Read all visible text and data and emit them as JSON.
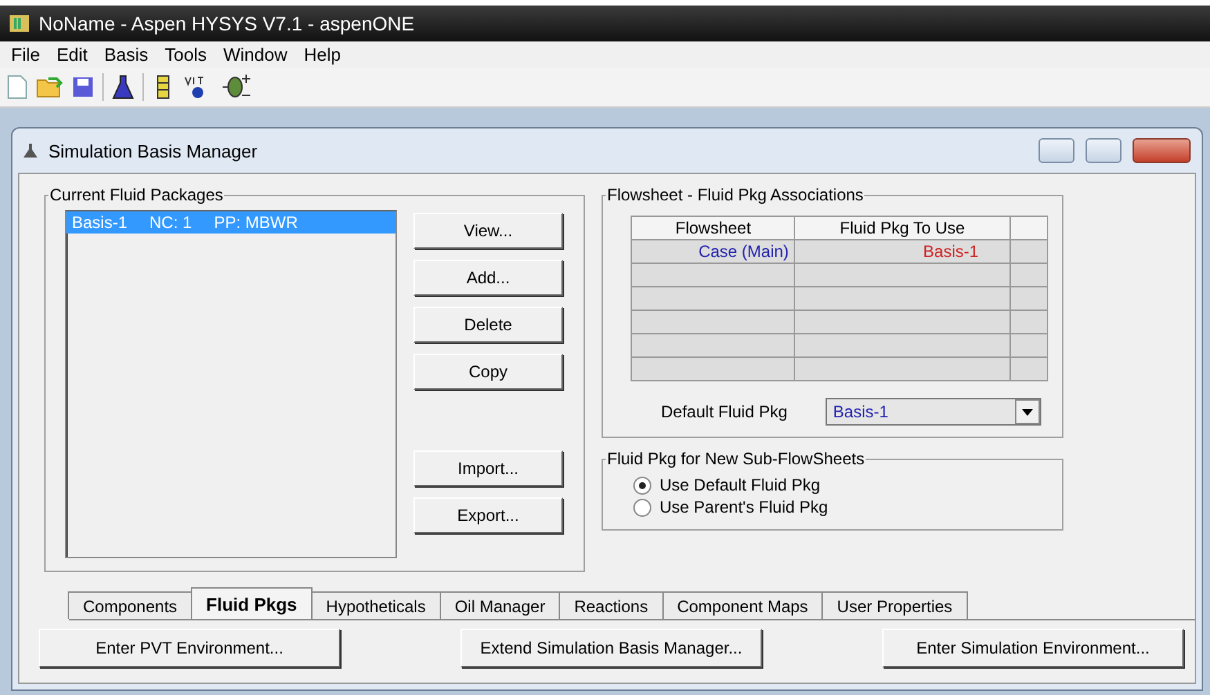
{
  "window": {
    "title": "NoName - Aspen HYSYS V7.1 - aspenONE"
  },
  "menu": [
    "File",
    "Edit",
    "Basis",
    "Tools",
    "Window",
    "Help"
  ],
  "child_window": {
    "title": "Simulation Basis Manager"
  },
  "current_fluid_packages": {
    "title": "Current Fluid Packages",
    "items": [
      {
        "name": "Basis-1",
        "nc": "NC: 1",
        "pp": "PP: MBWR",
        "selected": true
      }
    ],
    "buttons": [
      "View...",
      "Add...",
      "Delete",
      "Copy"
    ],
    "buttons_lower": [
      "Import...",
      "Export..."
    ]
  },
  "associations": {
    "title": "Flowsheet - Fluid Pkg Associations",
    "columns": [
      "Flowsheet",
      "Fluid Pkg To Use"
    ],
    "rows": [
      {
        "flowsheet": "Case (Main)",
        "fluid_pkg": "Basis-1"
      }
    ],
    "default_label": "Default Fluid Pkg",
    "default_value": "Basis-1"
  },
  "new_subflowsheets": {
    "title": "Fluid Pkg for New Sub-FlowSheets",
    "options": [
      {
        "label": "Use Default Fluid Pkg",
        "selected": true
      },
      {
        "label": "Use Parent's Fluid Pkg",
        "selected": false
      }
    ]
  },
  "tabs": [
    {
      "label": "Components",
      "selected": false
    },
    {
      "label": "Fluid Pkgs",
      "selected": true
    },
    {
      "label": "Hypotheticals",
      "selected": false
    },
    {
      "label": "Oil Manager",
      "selected": false
    },
    {
      "label": "Reactions",
      "selected": false
    },
    {
      "label": "Component Maps",
      "selected": false
    },
    {
      "label": "User Properties",
      "selected": false
    }
  ],
  "footer_buttons": [
    "Enter PVT Environment...",
    "Extend Simulation Basis Manager...",
    "Enter Simulation Environment..."
  ]
}
